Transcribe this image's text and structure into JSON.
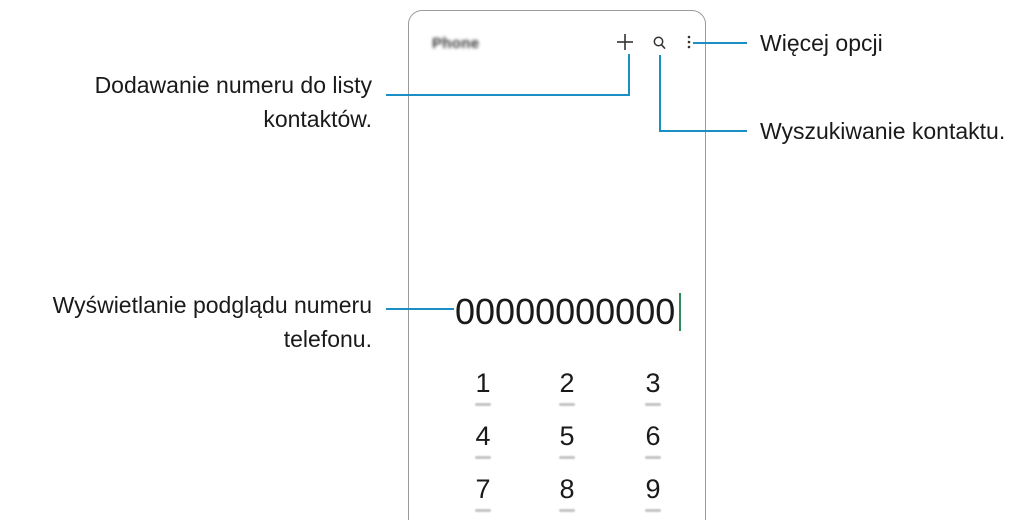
{
  "app": {
    "title": "Phone"
  },
  "toolbar": {
    "icons": [
      "plus-icon",
      "search-icon",
      "more-options-icon"
    ]
  },
  "dialer": {
    "number": "00000000000",
    "keys": [
      {
        "digit": "1"
      },
      {
        "digit": "2"
      },
      {
        "digit": "3"
      },
      {
        "digit": "4"
      },
      {
        "digit": "5"
      },
      {
        "digit": "6"
      },
      {
        "digit": "7"
      },
      {
        "digit": "8"
      },
      {
        "digit": "9"
      }
    ]
  },
  "callouts": {
    "more_options": "Więcej opcji",
    "search_contact": "Wyszukiwanie kontaktu.",
    "add_number_line1": "Dodawanie numeru do listy",
    "add_number_line2": "kontaktów.",
    "preview_line1": "Wyświetlanie podglądu numeru",
    "preview_line2": "telefonu."
  },
  "colors": {
    "callout_line": "#1b8fc3",
    "text_cursor": "#2e8b57"
  }
}
